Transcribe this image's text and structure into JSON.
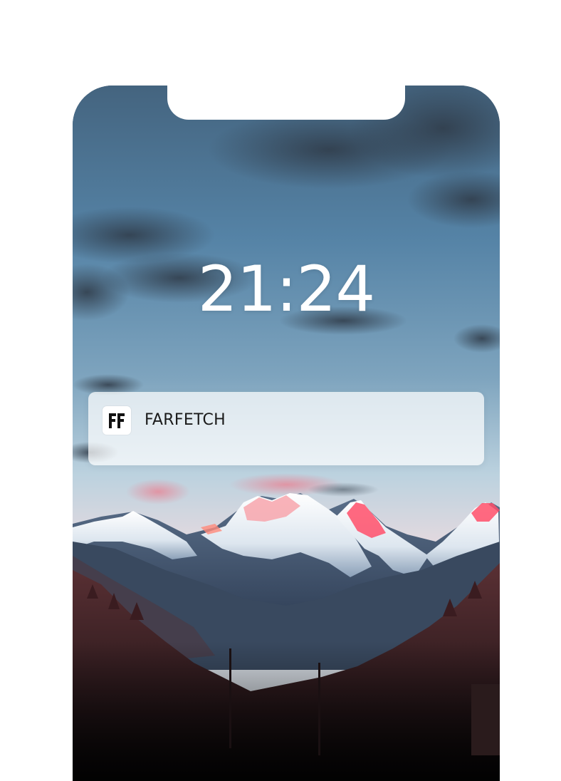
{
  "lock_screen": {
    "time": "21:24",
    "wallpaper": "snowy-mountain-range-at-dusk"
  },
  "notification": {
    "app_name": "FARFETCH",
    "icon": "farfetch-logo-icon"
  },
  "colors": {
    "sky_top": "#476b88",
    "sky_horizon": "#c8dbe6",
    "alpenglow": "#ff4f6a",
    "forest": "#5a2a2c",
    "notification_bg": "#ffffff"
  }
}
